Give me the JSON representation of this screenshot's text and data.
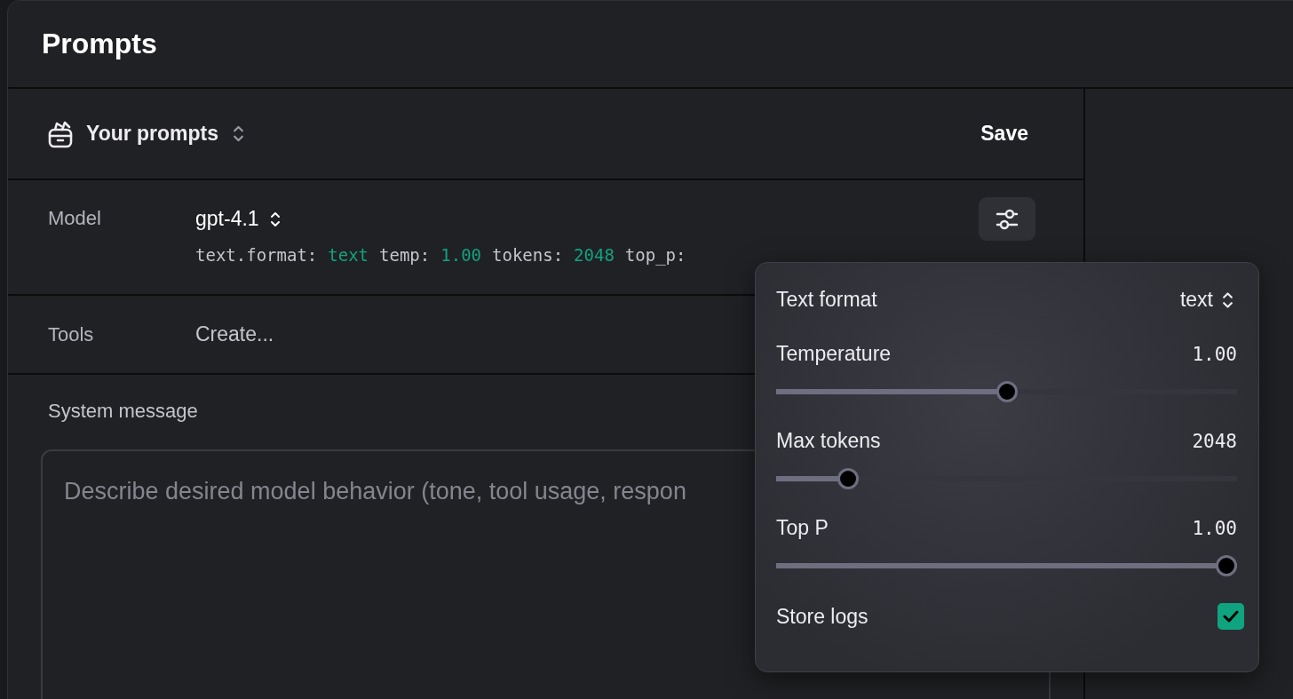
{
  "page": {
    "title": "Prompts"
  },
  "prompt_selector": {
    "label": "Your prompts"
  },
  "save_button": "Save",
  "model": {
    "label": "Model",
    "value": "gpt-4.1",
    "summary": [
      {
        "key": "text.format:",
        "value": "text"
      },
      {
        "key": "temp:",
        "value": "1.00"
      },
      {
        "key": "tokens:",
        "value": "2048"
      },
      {
        "key": "top_p:"
      }
    ]
  },
  "tools": {
    "label": "Tools",
    "value": "Create..."
  },
  "system_message": {
    "label": "System message",
    "placeholder": "Describe desired model behavior (tone, tool usage, respon"
  },
  "settings": {
    "text_format": {
      "label": "Text format",
      "value": "text"
    },
    "sliders": [
      {
        "label": "Temperature",
        "reading": "1.00",
        "level": 0.5
      },
      {
        "label": "Max tokens",
        "reading": "2048",
        "level": 0.14
      },
      {
        "label": "Top P",
        "reading": "1.00",
        "level": 1
      }
    ],
    "store_logs": {
      "label": "Store logs",
      "checked": true
    }
  }
}
